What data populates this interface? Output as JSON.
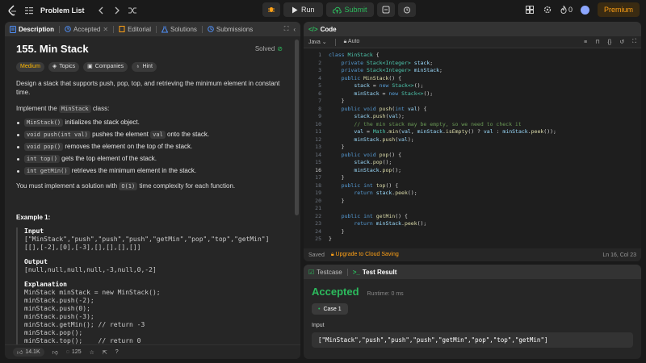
{
  "topbar": {
    "title": "Problem List",
    "run_label": "Run",
    "submit_label": "Submit",
    "fire_count": "0",
    "premium_label": "Premium"
  },
  "desc_panel": {
    "tabs": [
      "Description",
      "Accepted",
      "Editorial",
      "Solutions",
      "Submissions"
    ],
    "title": "155. Min Stack",
    "status": "Solved",
    "tags": [
      "Medium",
      "Topics",
      "Companies",
      "Hint"
    ],
    "intro": "Design a stack that supports push, pop, top, and retrieving the minimum element in constant time.",
    "impl_pre": "Implement the ",
    "impl_class": "MinStack",
    "impl_post": " class:",
    "methods": [
      {
        "code": "MinStack()",
        "text": " initializes the stack object."
      },
      {
        "code": "void push(int val)",
        "text": " pushes the element "
      },
      {
        "code": "void pop()",
        "text": " removes the element on the top of the stack."
      },
      {
        "code": "int top()",
        "text": " gets the top element of the stack."
      },
      {
        "code": "int getMin()",
        "text": " retrieves the minimum element in the stack."
      }
    ],
    "push_val": "val",
    "push_suffix": " onto the stack.",
    "constraint_pre": "You must implement a solution with ",
    "constraint_code": "O(1)",
    "constraint_post": " time complexity for each function.",
    "example_title": "Example 1:",
    "input_label": "Input",
    "input_line1": "[\"MinStack\",\"push\",\"push\",\"push\",\"getMin\",\"pop\",\"top\",\"getMin\"]",
    "input_line2": "[[],[-2],[0],[-3],[],[],[],[]]",
    "output_label": "Output",
    "output_line": "[null,null,null,null,-3,null,0,-2]",
    "explanation_label": "Explanation",
    "explanation": [
      "MinStack minStack = new MinStack();",
      "minStack.push(-2);",
      "minStack.push(0);",
      "minStack.push(-3);",
      "minStack.getMin(); // return -3",
      "minStack.pop();",
      "minStack.top();    // return 0"
    ],
    "likes": "14.1K",
    "comments": "125"
  },
  "code_panel": {
    "title": "Code",
    "language": "Java",
    "mode": "Auto",
    "status": "Saved",
    "upgrade": "Upgrade to Cloud Saving",
    "cursor": "Ln 16, Col 23"
  },
  "result_panel": {
    "tab_testcase": "Testcase",
    "tab_result": "Test Result",
    "verdict": "Accepted",
    "runtime": "Runtime: 0 ms",
    "case": "Case 1",
    "input_label": "Input",
    "input_value": "[\"MinStack\",\"push\",\"push\",\"push\",\"getMin\",\"pop\",\"top\",\"getMin\"]"
  }
}
